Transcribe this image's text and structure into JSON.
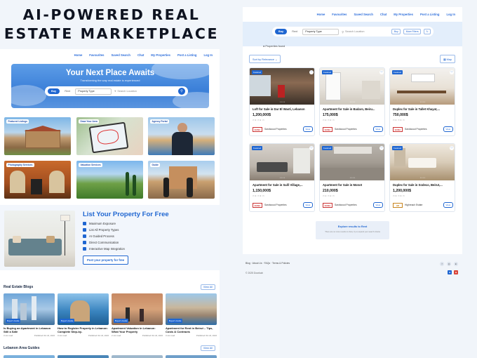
{
  "headline": {
    "line1": "AI-POWERED REAL",
    "line2": "ESTATE MARKETPLACE"
  },
  "nav": [
    "Home",
    "Favourites",
    "Saved Search",
    "Chat",
    "My Properties",
    "Post a Listing",
    "Log In"
  ],
  "hero": {
    "title": "Your Next Place Awaits",
    "subtitle": "Transforming the way real estate is experienced",
    "buy": "Buy",
    "rent": "Rent",
    "property_type": "Property Type",
    "location_placeholder": "Search Location"
  },
  "tiles": [
    "Featured Listings",
    "Draw Your Area",
    "Agency Portal",
    "Photography Services",
    "Valuation Services",
    "Guide"
  ],
  "list_property": {
    "title": "List Your Property For Free",
    "features": [
      "Maximum Exposure",
      "List All Property Types",
      "AI Guided Process",
      "Direct Communication",
      "Interactive Map Integration"
    ],
    "button": "Post your property for free"
  },
  "blogs": {
    "section_title": "Real Estate Blogs",
    "view_all": "View All",
    "items": [
      {
        "tag": "Buyer's Guide",
        "title": "Is Buying an Apartment in Lebanon Still a Safe",
        "read": "3 min read",
        "date": "Published Oct 22, 2022"
      },
      {
        "tag": "Buyer's Guide",
        "title": "How to Register Property in Lebanon: Complete Step-by-",
        "read": "3 min read",
        "date": "Published Oct 22, 2022"
      },
      {
        "tag": "Buyer's Guide",
        "title": "Apartment Valuation in Lebanon: What Your Property",
        "read": "2 min read",
        "date": "Published Oct 22, 2022"
      },
      {
        "tag": "Buyer's Guide",
        "title": "Apartment for Rent in Beirut – Tips, Costs & Contracts",
        "read": "3 min read",
        "date": "Published Oct 22, 2022"
      }
    ]
  },
  "guides": {
    "section_title": "Lebanon Area Guides",
    "view_all": "View All"
  },
  "results": {
    "buy": "Buy",
    "rent": "Rent",
    "property_type": "Property Type",
    "location_placeholder": "Search Location",
    "chip1": "Buy",
    "chip2": "More Filters",
    "found": "Properties found",
    "sort": "Sort by Relevance",
    "map": "Map",
    "cards": [
      {
        "badge": "Featured",
        "title": "Loft for Sale in Dar El Wasti, Lebanon",
        "price": "1,200,000$",
        "agency": "Sandwood Properties",
        "logo": "BANA",
        "view": "View"
      },
      {
        "badge": "Featured",
        "title": "Apartment for Sale in Badaro, Beiru...",
        "price": "175,000$",
        "agency": "Sandwood Properties",
        "logo": "BANA",
        "view": "View"
      },
      {
        "badge": "Featured",
        "title": "Duplex for Sale in Tallet Khayat,...",
        "price": "750,000$",
        "agency": "Sandwood Properties",
        "logo": "BANA",
        "view": "View"
      },
      {
        "badge": "Featured",
        "title": "Apartment for Sale in Saifi Village,...",
        "price": "1,150,000$",
        "agency": "Sandwood Properties",
        "logo": "BANA",
        "view": "View"
      },
      {
        "badge": "Featured",
        "title": "Apartment for Sale in Monot",
        "price": "210,000$",
        "agency": "Sandwood Properties",
        "logo": "BANA",
        "view": "View"
      },
      {
        "badge": "Featured",
        "title": "Duplex for Sale in Sodeco, Beirut,...",
        "price": "1,200,000$",
        "agency": "Highreach Estate",
        "logo": "HR",
        "view": "View"
      }
    ],
    "explore": "Explore results to Rent",
    "explore_sub": "There are no more results to show, try to expand your search criteria"
  },
  "footer": {
    "links": "Blog · About Us · FAQs · Terms & Policies",
    "copy": "© 2025 Doorkab"
  },
  "colors": {
    "accent": "#1f66d1",
    "page": "#f1f5fa"
  }
}
